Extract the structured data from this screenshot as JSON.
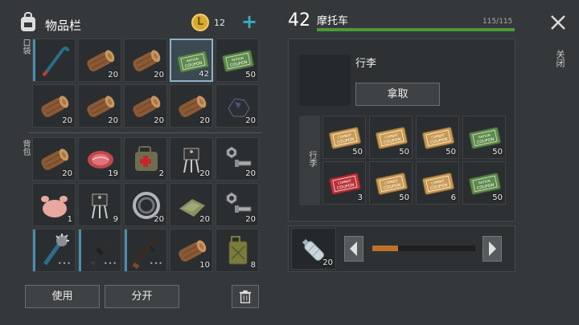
{
  "header": {
    "inventory_title": "物品栏",
    "coin_count": "12",
    "add_label": "+",
    "vehicle_level": "42",
    "vehicle_name": "摩托车",
    "vehicle_hp": "115/115",
    "close_label": "关闭"
  },
  "sections": {
    "pocket": "口袋",
    "backpack": "背包",
    "trunk": "行李"
  },
  "pocket_items": [
    {
      "icon": "crowbar-icon",
      "qty": ""
    },
    {
      "icon": "wood-log-icon",
      "qty": "20"
    },
    {
      "icon": "wood-log-icon",
      "qty": "20"
    },
    {
      "icon": "ration-coupon-icon",
      "qty": "42"
    },
    {
      "icon": "ration-coupon-icon",
      "qty": "50"
    },
    {
      "icon": "wood-log-icon",
      "qty": "20"
    },
    {
      "icon": "wood-log-icon",
      "qty": "20"
    },
    {
      "icon": "wood-log-icon",
      "qty": "20"
    },
    {
      "icon": "wood-log-icon",
      "qty": "20"
    },
    {
      "icon": "coal-icon",
      "qty": "20"
    }
  ],
  "backpack_items": [
    {
      "icon": "wood-log-icon",
      "qty": "20"
    },
    {
      "icon": "raw-meat-icon",
      "qty": "19"
    },
    {
      "icon": "medkit-bag-icon",
      "qty": "2"
    },
    {
      "icon": "transistor-icon",
      "qty": "20"
    },
    {
      "icon": "bolt-nut-icon",
      "qty": "20"
    },
    {
      "icon": "raw-chicken-icon",
      "qty": "1"
    },
    {
      "icon": "transistor-icon",
      "qty": "9"
    },
    {
      "icon": "bearing-icon",
      "qty": "20"
    },
    {
      "icon": "cloth-icon",
      "qty": "20"
    },
    {
      "icon": "bolt-nut-icon",
      "qty": "20"
    },
    {
      "icon": "spiked-club-icon",
      "qty": ""
    },
    {
      "icon": "rifle-icon",
      "qty": ""
    },
    {
      "icon": "ak-rifle-icon",
      "qty": ""
    },
    {
      "icon": "wood-log-icon",
      "qty": "10"
    },
    {
      "icon": "jerrycan-icon",
      "qty": "8"
    }
  ],
  "buttons": {
    "use": "使用",
    "split": "分开",
    "take": "拿取"
  },
  "storage": {
    "title": "行李",
    "items": [
      {
        "icon": "combat-coupon-icon",
        "qty": "50"
      },
      {
        "icon": "combat-coupon-icon",
        "qty": "50"
      },
      {
        "icon": "combat-coupon-icon",
        "qty": "50"
      },
      {
        "icon": "ration-coupon-icon",
        "qty": "50"
      },
      {
        "icon": "red-coupon-icon",
        "qty": "3"
      },
      {
        "icon": "combat-coupon-icon",
        "qty": "50"
      },
      {
        "icon": "combat-coupon-icon",
        "qty": "6"
      },
      {
        "icon": "ration-coupon-icon",
        "qty": "50"
      }
    ]
  },
  "fuel": {
    "icon": "water-bottle-icon",
    "qty": "20",
    "level": 0.25
  },
  "colors": {
    "hp_bar": "#4c9a3a",
    "fuel_bar": "#c0702a",
    "slot_accent": "#4a8fb0"
  }
}
